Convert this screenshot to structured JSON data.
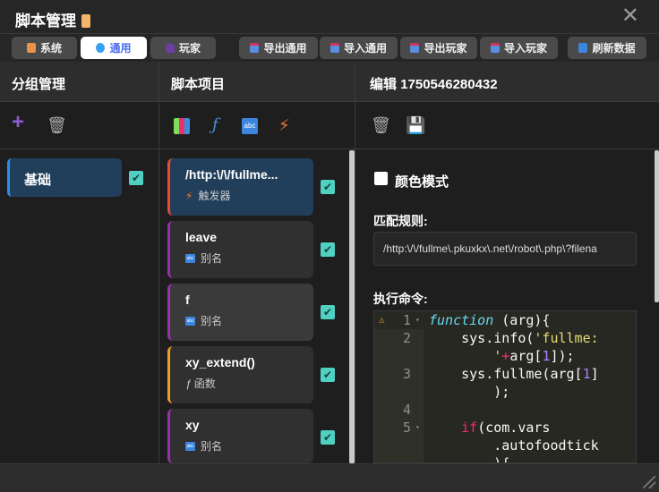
{
  "title": "脚本管理",
  "tabs": [
    {
      "label": "系统",
      "color": "#e8924a"
    },
    {
      "label": "通用",
      "color": "#3aa0f0"
    },
    {
      "label": "玩家",
      "color": "#6a3fa0"
    }
  ],
  "actions": [
    {
      "label": "导出通用"
    },
    {
      "label": "导入通用"
    },
    {
      "label": "导出玩家"
    },
    {
      "label": "导入玩家"
    },
    {
      "label": "刷新数据"
    }
  ],
  "columns": {
    "groups": "分组管理",
    "items": "脚本项目",
    "editor": "编辑 1750546280432"
  },
  "groups": [
    {
      "name": "基础",
      "checked": true
    }
  ],
  "items": [
    {
      "name": "/http:\\/\\/fullme...",
      "type": "触发器",
      "accent": "#e84a3a",
      "active": true,
      "checked": true
    },
    {
      "name": "leave",
      "type": "别名",
      "accent": "#9b2fae",
      "checked": true
    },
    {
      "name": "f",
      "type": "别名",
      "accent": "#9b2fae",
      "checked": true
    },
    {
      "name": "xy_extend()",
      "type": "函数",
      "accent": "#f0a020",
      "checked": true
    },
    {
      "name": "xy",
      "type": "别名",
      "accent": "#9b2fae",
      "checked": true
    }
  ],
  "editor": {
    "color_mode_label": "颜色模式",
    "color_mode": false,
    "match_label": "匹配规则:",
    "match_value": "/http:\\/\\/fullme\\.pkuxkx\\.net\\/robot\\.php\\?filena",
    "command_label": "执行命令:",
    "line_numbers": [
      "1",
      "2",
      "",
      "3",
      "",
      "4",
      "5",
      "",
      ""
    ]
  }
}
